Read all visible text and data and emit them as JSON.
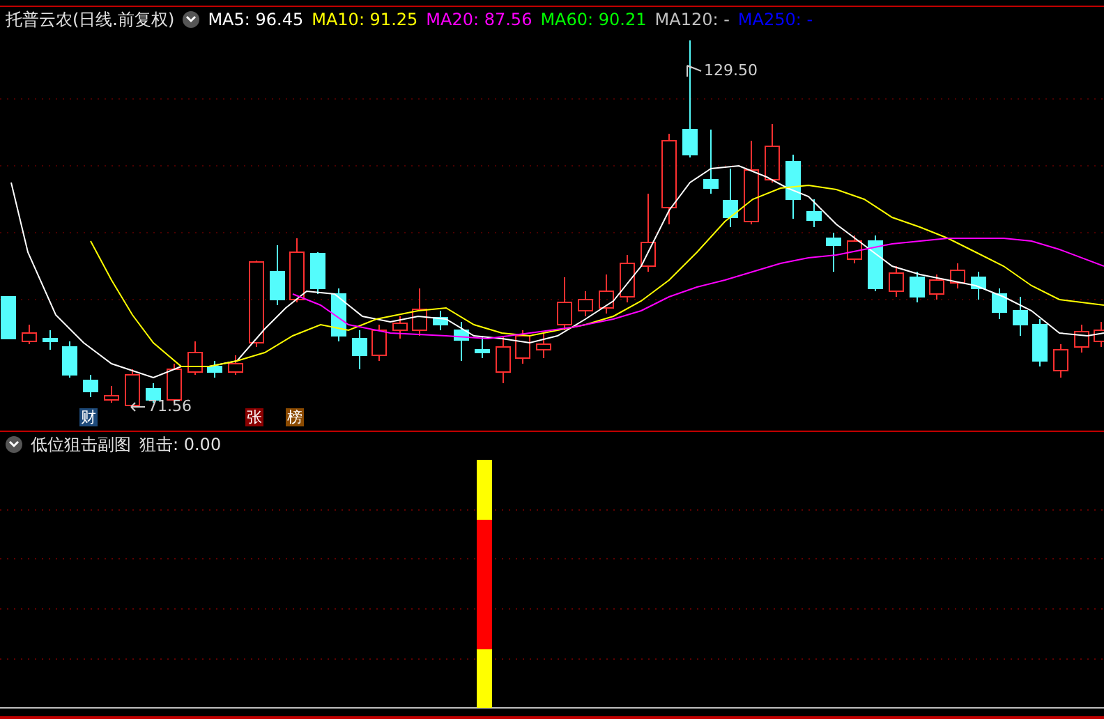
{
  "chart_header": {
    "stock_title": "托普云农(日线.前复权)",
    "indicators": [
      {
        "text": "MA5: 96.45",
        "color": "#ffffff"
      },
      {
        "text": "MA10: 91.25",
        "color": "#ffff00"
      },
      {
        "text": "MA20: 87.56",
        "color": "#ff00ff"
      },
      {
        "text": "MA60: 90.21",
        "color": "#00ff00"
      },
      {
        "text": "MA120: -",
        "color": "#c0c0c0"
      },
      {
        "text": "MA250: -",
        "color": "#0000ff"
      }
    ]
  },
  "price_marks": [
    {
      "kind": "high",
      "text": "129.50"
    },
    {
      "kind": "low",
      "text": "71.56"
    }
  ],
  "event_tags": [
    {
      "text": "财",
      "color": "#1e4a7a"
    },
    {
      "text": "张",
      "color": "#8b0000"
    },
    {
      "text": "榜",
      "color": "#8b4a00"
    }
  ],
  "sub_chart": {
    "title": "低位狙击副图",
    "reading": "狙击: 0.00"
  }
}
